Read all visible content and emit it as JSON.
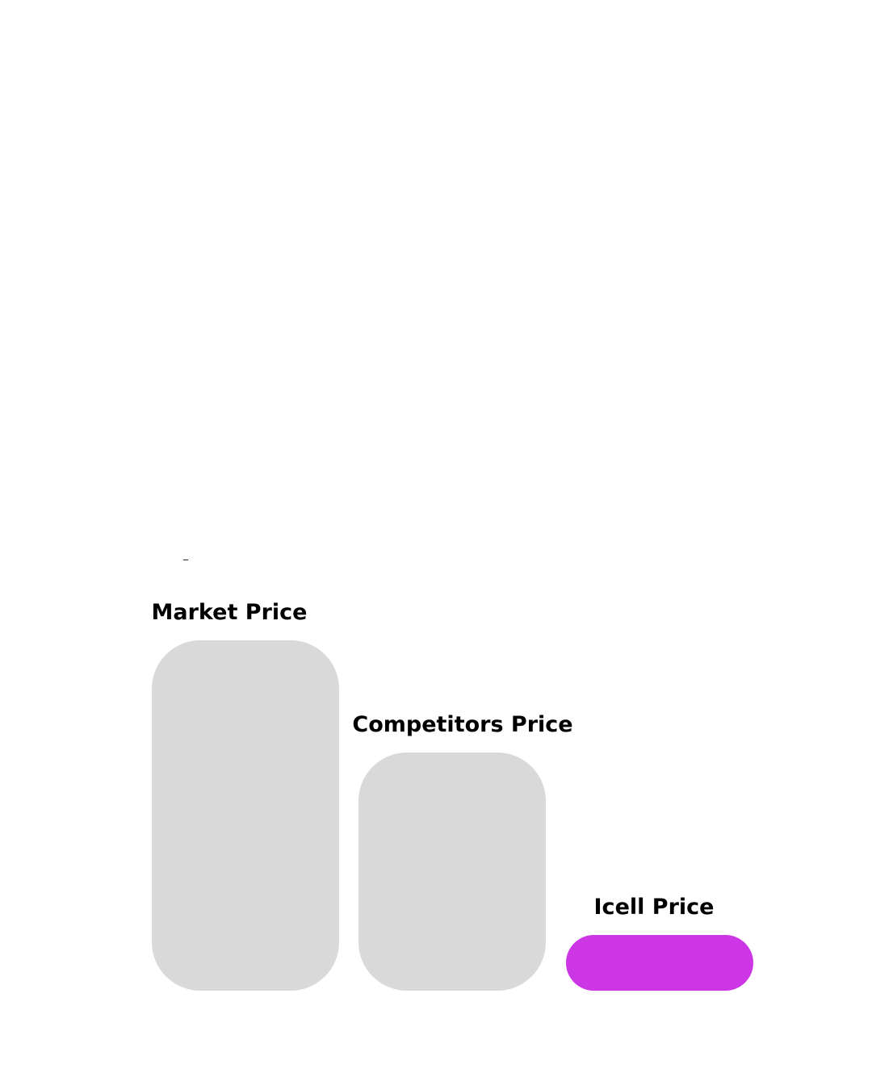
{
  "chart_data": {
    "type": "bar",
    "categories": [
      "Market Price",
      "Competitors Price",
      "Icell Price"
    ],
    "values": [
      100,
      68,
      16
    ],
    "ylim": [
      0,
      100
    ],
    "grid": false,
    "colors": [
      "#d9d9d9",
      "#d9d9d9",
      "#cc36e4"
    ]
  }
}
